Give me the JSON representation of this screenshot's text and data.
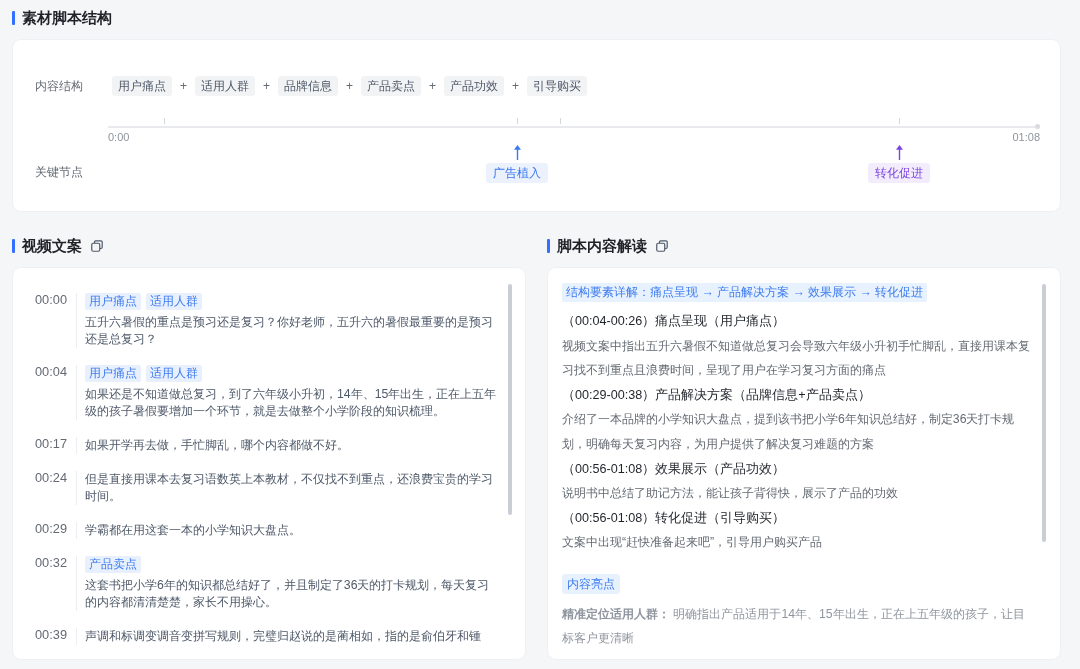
{
  "structure": {
    "title": "素材脚本结构",
    "content_structure": {
      "label": "内容结构",
      "parts": [
        {
          "label": "用户痛点"
        },
        {
          "joiner": "+",
          "label": "适用人群"
        },
        {
          "joiner": "+",
          "label": "品牌信息"
        },
        {
          "joiner": "+",
          "label": "产品卖点"
        },
        {
          "joiner": "+",
          "label": "产品功效"
        },
        {
          "joiner": "+",
          "label": "引导购买"
        }
      ]
    },
    "timeline": {
      "start_time": "0:00",
      "end_time": "01:08",
      "ticks": [
        {
          "level": 0.06
        },
        {
          "level": 0.439
        },
        {
          "level": 0.485
        },
        {
          "level": 0.849
        }
      ]
    },
    "key_nodes": {
      "label": "关键节点",
      "markers": [
        {
          "label": "广告植入",
          "level": 0.439,
          "color": "#3a78f0"
        },
        {
          "label": "转化促进",
          "level": 0.849,
          "color": "#7b44e0"
        }
      ]
    }
  },
  "video_script": {
    "title": "视频文案",
    "entries": [
      {
        "time": "00:00",
        "tags": [
          "用户痛点",
          "适用人群"
        ],
        "text": "五升六暑假的重点是预习还是复习？你好老师，五升六的暑假最重要的是预习还是总复习？"
      },
      {
        "time": "00:04",
        "tags": [
          "用户痛点",
          "适用人群"
        ],
        "text": "如果还是不知道做总复习，到了六年级小升初，14年、15年出生，正在上五年级的孩子暑假要增加一个环节，就是去做整个小学阶段的知识梳理。"
      },
      {
        "time": "00:17",
        "text": "如果开学再去做，手忙脚乱，哪个内容都做不好。"
      },
      {
        "time": "00:24",
        "text": "但是直接用课本去复习语数英上本教材，不仅找不到重点，还浪费宝贵的学习时间。"
      },
      {
        "time": "00:29",
        "text": "学霸都在用这套一本的小学知识大盘点。"
      },
      {
        "time": "00:32",
        "tags": [
          "产品卖点"
        ],
        "text": "这套书把小学6年的知识都总结好了，并且制定了36天的打卡规划，每天复习的内容都清清楚楚，家长不用操心。"
      },
      {
        "time": "00:39",
        "text": "声调和标调变调音变拼写规则，完璧归赵说的是蔺相如，指的是俞伯牙和锺"
      }
    ]
  },
  "script_analysis": {
    "title": "脚本内容解读",
    "summary": "结构要素详解：痛点呈现 → 产品解决方案 → 效果展示 → 转化促进",
    "sections": [
      {
        "heading": "（00:04-00:26）痛点呈现（用户痛点）",
        "text": "视频文案中指出五升六暑假不知道做总复习会导致六年级小升初手忙脚乱，直接用课本复习找不到重点且浪费时间，呈现了用户在学习复习方面的痛点"
      },
      {
        "heading": "（00:29-00:38）产品解决方案（品牌信息+产品卖点）",
        "text": "介绍了一本品牌的小学知识大盘点，提到该书把小学6年知识总结好，制定36天打卡规划，明确每天复习内容，为用户提供了解决复习难题的方案"
      },
      {
        "heading": "（00:56-01:08）效果展示（产品功效）",
        "text": "说明书中总结了助记方法，能让孩子背得快，展示了产品的功效"
      },
      {
        "heading": "（00:56-01:08）转化促进（引导购买）",
        "text": "文案中出现“赶快准备起来吧”，引导用户购买产品"
      }
    ],
    "highlights": {
      "tag": "内容亮点",
      "items": [
        "**精准定位适用人群：** 明确指出产品适用于14年、15年出生，正在上五年级的孩子，让目标客户更清晰"
      ]
    }
  }
}
